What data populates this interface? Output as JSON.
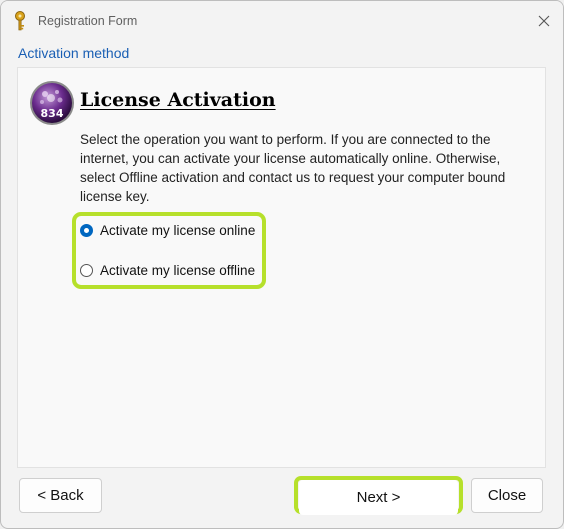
{
  "window": {
    "title": "Registration Form",
    "close_symbol": "✕"
  },
  "section": {
    "label": "Activation method"
  },
  "content": {
    "logo_text": "834",
    "heading": "License Activation",
    "description": "Select the operation you want to perform. If you are connected to the internet, you can activate your license automatically online. Otherwise, select Offline activation and contact us to request your computer bound license key."
  },
  "options": {
    "selected": "online",
    "online_label": "Activate my license online",
    "offline_label": "Activate my license offline"
  },
  "buttons": {
    "back": "< Back",
    "next": "Next >",
    "close": "Close"
  },
  "colors": {
    "highlight": "#b6e02b",
    "accent": "#0067c0",
    "section_label": "#1a5fb4"
  },
  "icons": {
    "app": "key-icon",
    "logo": "license-seal-icon",
    "close": "close-icon"
  }
}
